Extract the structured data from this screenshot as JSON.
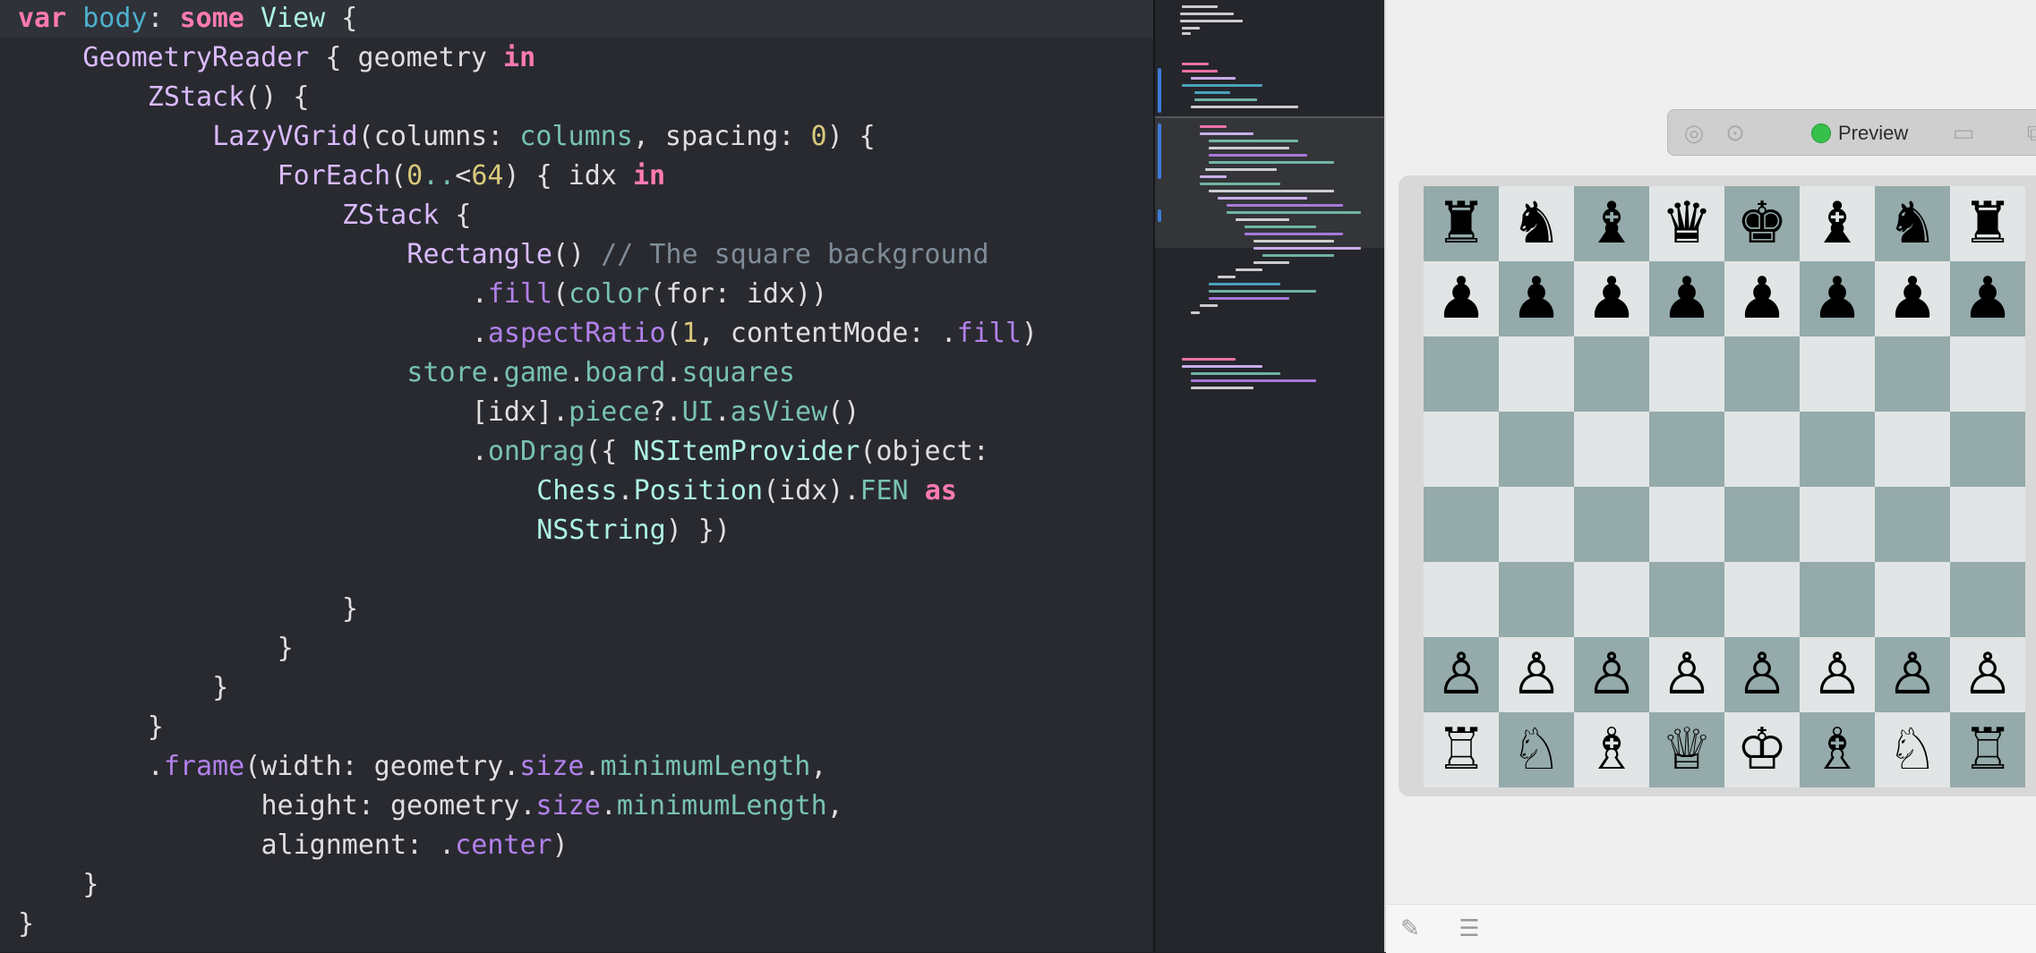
{
  "editor": {
    "lines": [
      {
        "indent": 0,
        "tokens": [
          [
            "kw",
            "var"
          ],
          [
            "plain",
            " "
          ],
          [
            "var",
            "body"
          ],
          [
            "plain",
            ": "
          ],
          [
            "kw",
            "some"
          ],
          [
            "plain",
            " "
          ],
          [
            "ptype",
            "View"
          ],
          [
            "plain",
            " {"
          ]
        ]
      },
      {
        "indent": 4,
        "tokens": [
          [
            "type",
            "GeometryReader"
          ],
          [
            "plain",
            " { geometry "
          ],
          [
            "kw",
            "in"
          ]
        ]
      },
      {
        "indent": 8,
        "tokens": [
          [
            "type",
            "ZStack"
          ],
          [
            "plain",
            "() {"
          ]
        ]
      },
      {
        "indent": 12,
        "tokens": [
          [
            "type",
            "LazyVGrid"
          ],
          [
            "plain",
            "(columns: "
          ],
          [
            "prop",
            "columns"
          ],
          [
            "plain",
            ", spacing: "
          ],
          [
            "num",
            "0"
          ],
          [
            "plain",
            ") {"
          ]
        ]
      },
      {
        "indent": 16,
        "tokens": [
          [
            "type",
            "ForEach"
          ],
          [
            "plain",
            "("
          ],
          [
            "num",
            "0"
          ],
          [
            "prop",
            ".."
          ],
          [
            "plain",
            "<"
          ],
          [
            "num",
            "64"
          ],
          [
            "plain",
            ") { idx "
          ],
          [
            "kw",
            "in"
          ]
        ]
      },
      {
        "indent": 20,
        "tokens": [
          [
            "type",
            "ZStack"
          ],
          [
            "plain",
            " {"
          ]
        ]
      },
      {
        "indent": 24,
        "tokens": [
          [
            "type",
            "Rectangle"
          ],
          [
            "plain",
            "() "
          ],
          [
            "comment",
            "// The square background"
          ]
        ]
      },
      {
        "indent": 28,
        "tokens": [
          [
            "plain",
            "."
          ],
          [
            "meth",
            "fill"
          ],
          [
            "plain",
            "("
          ],
          [
            "prop",
            "color"
          ],
          [
            "plain",
            "(for: idx))"
          ]
        ]
      },
      {
        "indent": 28,
        "tokens": [
          [
            "plain",
            "."
          ],
          [
            "meth",
            "aspectRatio"
          ],
          [
            "plain",
            "("
          ],
          [
            "num",
            "1"
          ],
          [
            "plain",
            ", contentMode: ."
          ],
          [
            "meth",
            "fill"
          ],
          [
            "plain",
            ")"
          ]
        ]
      },
      {
        "indent": 24,
        "tokens": [
          [
            "prop",
            "store"
          ],
          [
            "plain",
            "."
          ],
          [
            "prop",
            "game"
          ],
          [
            "plain",
            "."
          ],
          [
            "prop",
            "board"
          ],
          [
            "plain",
            "."
          ],
          [
            "prop",
            "squares"
          ]
        ]
      },
      {
        "indent": 28,
        "tokens": [
          [
            "plain",
            "[idx]."
          ],
          [
            "prop",
            "piece"
          ],
          [
            "plain",
            "?."
          ],
          [
            "prop",
            "UI"
          ],
          [
            "plain",
            "."
          ],
          [
            "prop",
            "asView"
          ],
          [
            "plain",
            "()"
          ]
        ]
      },
      {
        "indent": 28,
        "tokens": [
          [
            "plain",
            "."
          ],
          [
            "prop",
            "onDrag"
          ],
          [
            "plain",
            "({ "
          ],
          [
            "ptype",
            "NSItemProvider"
          ],
          [
            "plain",
            "(object:"
          ]
        ]
      },
      {
        "indent": 32,
        "tokens": [
          [
            "ptype",
            "Chess"
          ],
          [
            "plain",
            "."
          ],
          [
            "ptype",
            "Position"
          ],
          [
            "plain",
            "(idx)."
          ],
          [
            "prop",
            "FEN"
          ],
          [
            "plain",
            " "
          ],
          [
            "kw",
            "as"
          ]
        ]
      },
      {
        "indent": 32,
        "tokens": [
          [
            "ptype",
            "NSString"
          ],
          [
            "plain",
            ") })"
          ]
        ]
      },
      {
        "indent": 0,
        "tokens": []
      },
      {
        "indent": 20,
        "tokens": [
          [
            "plain",
            "}"
          ]
        ]
      },
      {
        "indent": 16,
        "tokens": [
          [
            "plain",
            "}"
          ]
        ]
      },
      {
        "indent": 12,
        "tokens": [
          [
            "plain",
            "}"
          ]
        ]
      },
      {
        "indent": 8,
        "tokens": [
          [
            "plain",
            "}"
          ]
        ]
      },
      {
        "indent": 8,
        "tokens": [
          [
            "plain",
            "."
          ],
          [
            "meth",
            "frame"
          ],
          [
            "plain",
            "(width: geometry."
          ],
          [
            "meth",
            "size"
          ],
          [
            "plain",
            "."
          ],
          [
            "prop",
            "minimumLength"
          ],
          [
            "plain",
            ","
          ]
        ]
      },
      {
        "indent": 15,
        "tokens": [
          [
            "plain",
            "height: geometry."
          ],
          [
            "meth",
            "size"
          ],
          [
            "plain",
            "."
          ],
          [
            "prop",
            "minimumLength"
          ],
          [
            "plain",
            ","
          ]
        ]
      },
      {
        "indent": 15,
        "tokens": [
          [
            "plain",
            "alignment: ."
          ],
          [
            "meth",
            "center"
          ],
          [
            "plain",
            ")"
          ]
        ]
      },
      {
        "indent": 4,
        "tokens": [
          [
            "plain",
            "}"
          ]
        ]
      },
      {
        "indent": 0,
        "tokens": [
          [
            "plain",
            "}"
          ]
        ]
      }
    ]
  },
  "minimap": {
    "colors": [
      "#dfdfe0",
      "#ff7ab2",
      "#78c2b3",
      "#dabaff",
      "#4eb0cc",
      "#b281eb"
    ]
  },
  "preview": {
    "label": "Preview",
    "status_color": "#36c24a",
    "icons": {
      "live": "play-circle-icon",
      "inspect": "inspect-icon",
      "device": "device-settings-icon",
      "duplicate": "duplicate-preview-icon",
      "pin": "pin-icon",
      "settings": "canvas-settings-icon"
    },
    "board": {
      "light_color": "#e1e5e5",
      "dark_color": "#95aaaa",
      "ranks": [
        [
          "♜",
          "♞",
          "♝",
          "♛",
          "♚",
          "♝",
          "♞",
          "♜"
        ],
        [
          "♟",
          "♟",
          "♟",
          "♟",
          "♟",
          "♟",
          "♟",
          "♟"
        ],
        [
          "",
          "",
          "",
          "",
          "",
          "",
          "",
          ""
        ],
        [
          "",
          "",
          "",
          "",
          "",
          "",
          "",
          ""
        ],
        [
          "",
          "",
          "",
          "",
          "",
          "",
          "",
          ""
        ],
        [
          "",
          "",
          "",
          "",
          "",
          "",
          "",
          ""
        ],
        [
          "♙",
          "♙",
          "♙",
          "♙",
          "♙",
          "♙",
          "♙",
          "♙"
        ],
        [
          "♖",
          "♘",
          "♗",
          "♕",
          "♔",
          "♗",
          "♘",
          "♖"
        ]
      ]
    }
  }
}
